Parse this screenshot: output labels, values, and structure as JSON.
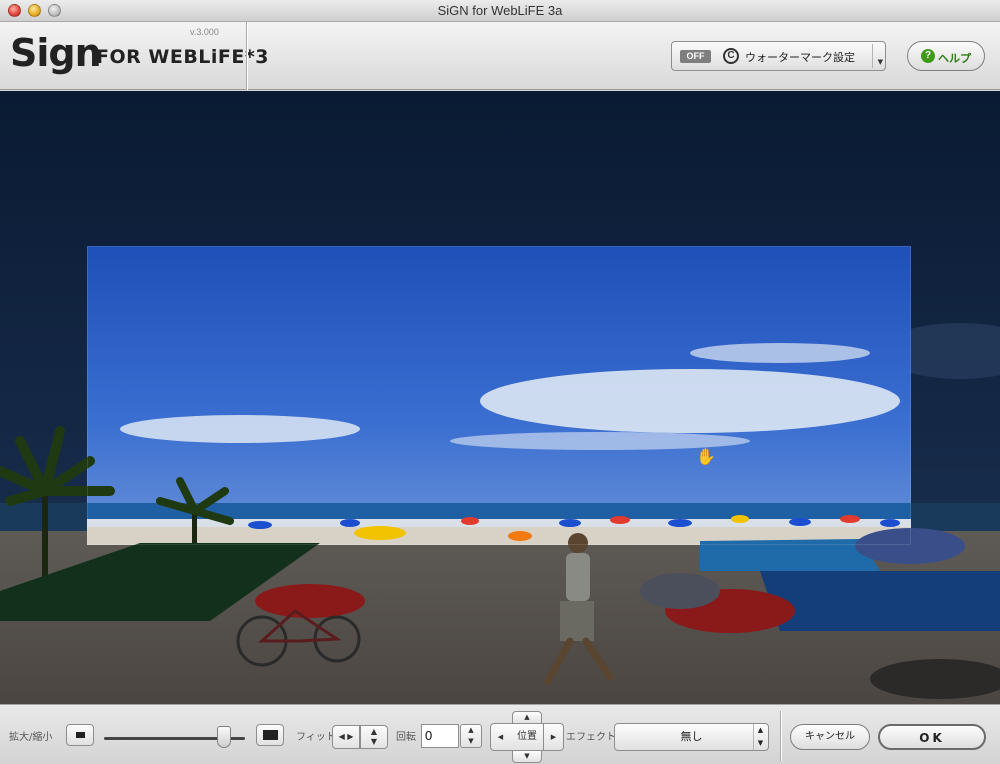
{
  "window": {
    "title": "SiGN for WebLiFE 3a"
  },
  "header": {
    "logo_main": "Sign",
    "logo_sub": "FOR WEBLiFE*3",
    "version": "v.3.000",
    "watermark": {
      "state": "OFF",
      "label": "ウォーターマーク設定"
    },
    "help_label": "ヘルプ"
  },
  "toolbar": {
    "zoom_label": "拡大/縮小",
    "zoom_level": 0.85,
    "fit_label": "フィット",
    "rotate_label": "回転",
    "rotate_value": "0",
    "position_label": "位置",
    "effect_label": "エフェクト",
    "effect_value": "無し",
    "cancel_label": "キャンセル",
    "ok_label": "OK"
  },
  "colors": {
    "accent_help": "#3f9a1a",
    "canvas_bg": "#0d1d36"
  }
}
